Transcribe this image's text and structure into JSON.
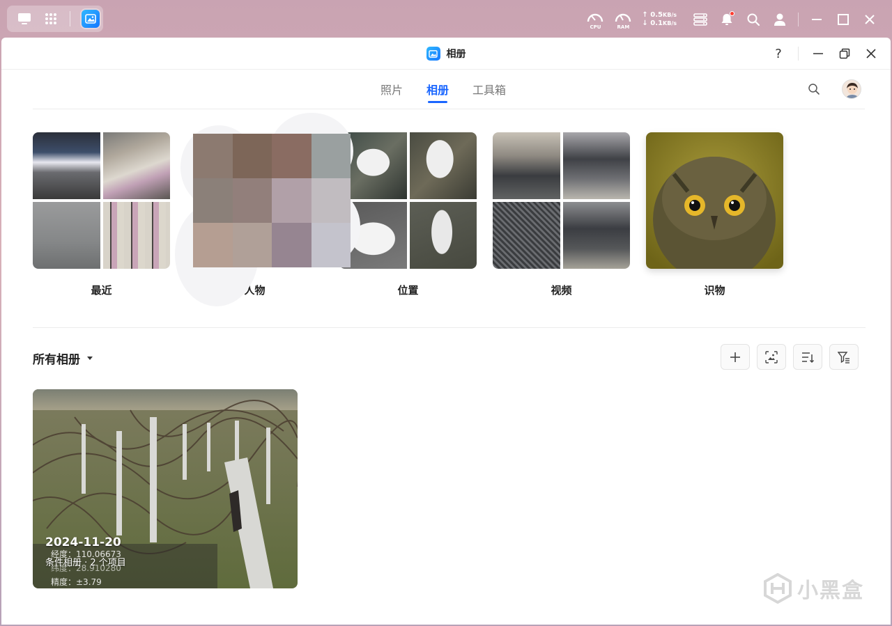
{
  "taskbar": {
    "gauges": [
      {
        "label": "CPU"
      },
      {
        "label": "RAM"
      }
    ],
    "net_up": "0.5",
    "net_down": "0.1",
    "net_unit": "KB/s"
  },
  "window": {
    "title": "相册",
    "help": "?"
  },
  "tabs": [
    {
      "label": "照片",
      "active": false
    },
    {
      "label": "相册",
      "active": true
    },
    {
      "label": "工具箱",
      "active": false
    }
  ],
  "categories": [
    {
      "label": "最近"
    },
    {
      "label": "人物"
    },
    {
      "label": "位置"
    },
    {
      "label": "视频"
    },
    {
      "label": "识物"
    }
  ],
  "albums": {
    "title": "所有相册",
    "items": [
      {
        "date": "2024-11-20",
        "description": "条件相册 · 2 个项目",
        "longitude": "经度：110.06673",
        "latitude": "纬度：28.910280",
        "precision": "精度：±3.79"
      }
    ]
  },
  "watermark": "小黑盒",
  "colors": {
    "accent": "#1a66ff",
    "notification": "#ff3b30"
  }
}
